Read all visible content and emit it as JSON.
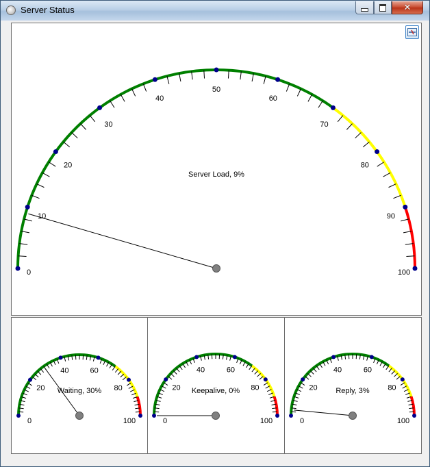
{
  "window": {
    "title": "Server Status",
    "close_glyph": "✕"
  },
  "toolbar": {
    "settings_icon": "gauge-settings-icon"
  },
  "colors": {
    "ok": "#008000",
    "warn": "#ffff00",
    "danger": "#ff0000",
    "dot": "#00008b",
    "hub": "#808080"
  },
  "gauges": [
    {
      "id": "server-load",
      "label": "Server Load, 9%",
      "value": 9,
      "ticks": [
        "0",
        "10",
        "20",
        "30",
        "40",
        "50",
        "60",
        "70",
        "80",
        "90",
        "100"
      ]
    },
    {
      "id": "waiting",
      "label": "Waiting, 30%",
      "value": 30,
      "ticks": [
        "0",
        "20",
        "40",
        "60",
        "80",
        "100"
      ]
    },
    {
      "id": "keepalive",
      "label": "Keepalive, 0%",
      "value": 0,
      "ticks": [
        "0",
        "20",
        "40",
        "60",
        "80",
        "100"
      ]
    },
    {
      "id": "reply",
      "label": "Reply, 3%",
      "value": 3,
      "ticks": [
        "0",
        "20",
        "40",
        "60",
        "80",
        "100"
      ]
    }
  ]
}
